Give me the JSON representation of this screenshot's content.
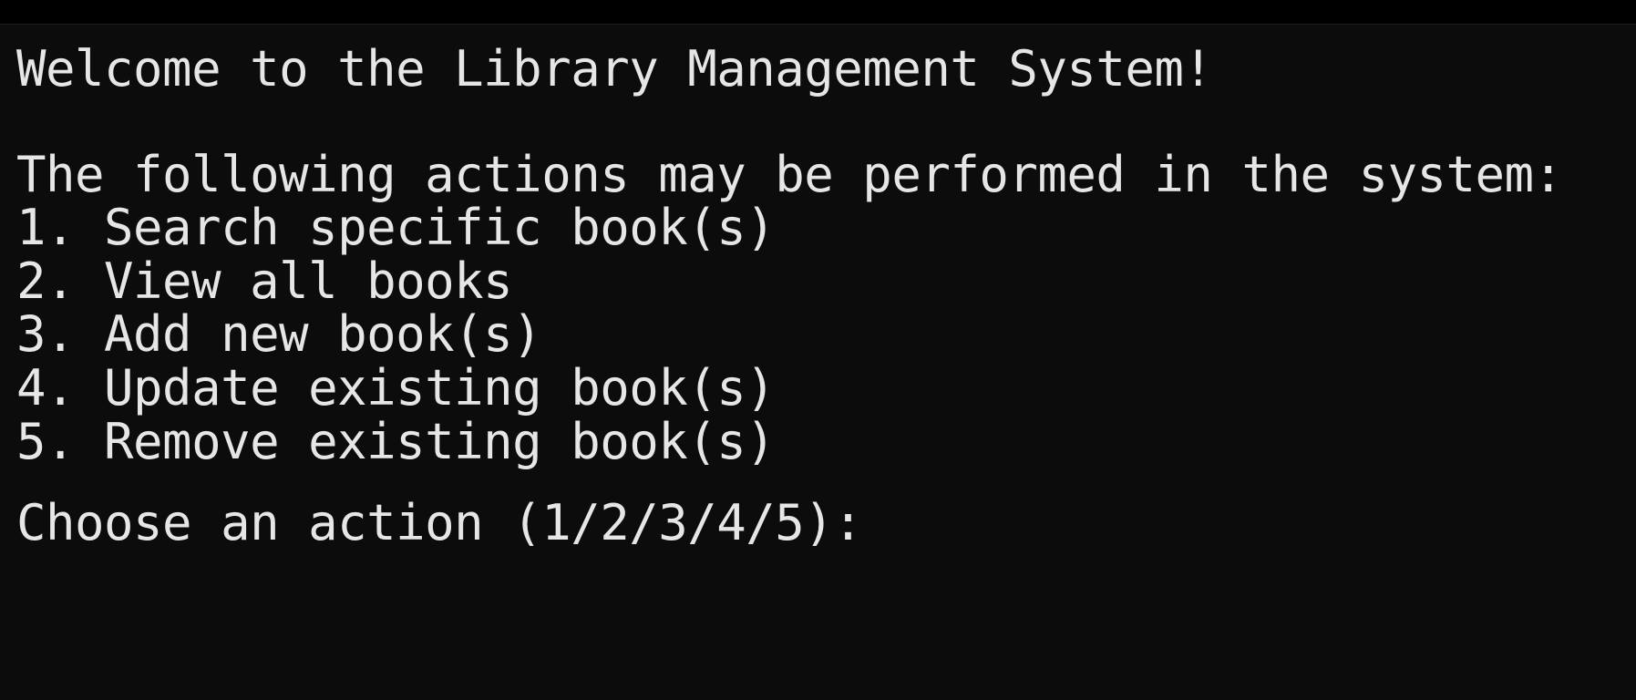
{
  "terminal": {
    "welcome": "Welcome to the Library Management System!",
    "intro": "The following actions may be performed in the system:",
    "actions": [
      "1. Search specific book(s)",
      "2. View all books",
      "3. Add new book(s)",
      "4. Update existing book(s)",
      "5. Remove existing book(s)"
    ],
    "prompt": "Choose an action (1/2/3/4/5):"
  }
}
